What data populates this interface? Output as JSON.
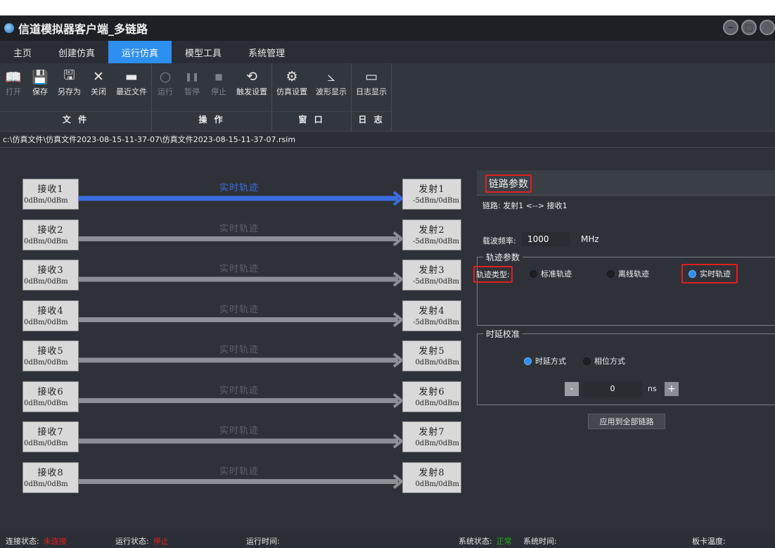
{
  "window": {
    "title": "信道模拟器客户端_多链路"
  },
  "menu": {
    "items": [
      "主页",
      "创建仿真",
      "运行仿真",
      "模型工具",
      "系统管理"
    ],
    "active_index": 2
  },
  "ribbon": {
    "groups": [
      {
        "label": "文 件",
        "buttons": [
          {
            "label": "打开",
            "icon": "open-book-icon",
            "enabled": false
          },
          {
            "label": "保存",
            "icon": "save-icon",
            "enabled": true
          },
          {
            "label": "另存为",
            "icon": "save-as-icon",
            "enabled": true
          },
          {
            "label": "关闭",
            "icon": "close-icon",
            "enabled": true
          },
          {
            "label": "最近文件",
            "icon": "folder-icon",
            "enabled": true
          }
        ]
      },
      {
        "label": "操 作",
        "buttons": [
          {
            "label": "运行",
            "icon": "run-icon",
            "enabled": false
          },
          {
            "label": "暂停",
            "icon": "pause-icon",
            "enabled": false
          },
          {
            "label": "停止",
            "icon": "stop-icon",
            "enabled": false
          },
          {
            "label": "触发设置",
            "icon": "trigger-icon",
            "enabled": true
          }
        ]
      },
      {
        "label": "窗 口",
        "buttons": [
          {
            "label": "仿真设置",
            "icon": "gear-icon",
            "enabled": true
          },
          {
            "label": "波形显示",
            "icon": "chart-icon",
            "enabled": true
          }
        ]
      },
      {
        "label": "日 志",
        "buttons": [
          {
            "label": "日志显示",
            "icon": "monitor-icon",
            "enabled": true
          }
        ]
      }
    ]
  },
  "path": "c:\\仿真文件\\仿真文件2023-08-15-11-37-07\\仿真文件2023-08-15-11-37-07.rsim",
  "links": [
    {
      "rx": "接收1",
      "rx_power": "0dBm/0dBm",
      "label": "实时轨迹",
      "tx": "发射1",
      "tx_power": "-5dBm/0dBm",
      "active": true
    },
    {
      "rx": "接收2",
      "rx_power": "0dBm/0dBm",
      "label": "实时轨迹",
      "tx": "发射2",
      "tx_power": "-5dBm/0dBm",
      "active": false
    },
    {
      "rx": "接收3",
      "rx_power": "0dBm/0dBm",
      "label": "实时轨迹",
      "tx": "发射3",
      "tx_power": "-5dBm/0dBm",
      "active": false
    },
    {
      "rx": "接收4",
      "rx_power": "0dBm/0dBm",
      "label": "实时轨迹",
      "tx": "发射4",
      "tx_power": "-5dBm/0dBm",
      "active": false
    },
    {
      "rx": "接收5",
      "rx_power": "0dBm/0dBm",
      "label": "实时轨迹",
      "tx": "发射5",
      "tx_power": "0dBm/0dBm",
      "active": false
    },
    {
      "rx": "接收6",
      "rx_power": "0dBm/0dBm",
      "label": "实时轨迹",
      "tx": "发射6",
      "tx_power": "0dBm/0dBm",
      "active": false
    },
    {
      "rx": "接收7",
      "rx_power": "0dBm/0dBm",
      "label": "实时轨迹",
      "tx": "发射7",
      "tx_power": "0dBm/0dBm",
      "active": false
    },
    {
      "rx": "接收8",
      "rx_power": "0dBm/0dBm",
      "label": "实时轨迹",
      "tx": "发射8",
      "tx_power": "0dBm/0dBm",
      "active": false
    }
  ],
  "panel": {
    "title": "链路参数",
    "link_info": "链路: 发射1 <--> 接收1",
    "carrier_label": "载波频率:",
    "carrier_value": "1000",
    "carrier_unit": "MHz",
    "track_group": "轨迹参数",
    "track_type_label": "轨迹类型:",
    "track_options": [
      "标准轨迹",
      "离线轨迹",
      "实时轨迹"
    ],
    "track_selected": 2,
    "delay_group": "时延校准",
    "delay_options": [
      "时延方式",
      "相位方式"
    ],
    "delay_selected": 0,
    "delay_value": "0",
    "delay_unit": "ns",
    "minus": "-",
    "plus": "+",
    "apply": "应用到全部链路"
  },
  "status": {
    "conn_label": "连接状态:",
    "conn_value": "未连接",
    "run_label": "运行状态:",
    "run_value": "停止",
    "time_label": "运行时间:",
    "sys_label": "系统状态:",
    "sys_value": "正常",
    "systime_label": "系统时间:",
    "temp_label": "板卡温度:"
  },
  "colors": {
    "accent": "#2d8ff0",
    "active_link": "#3b6de0",
    "idle_link": "#8c8f94",
    "error": "#e02020",
    "ok": "#20b020",
    "highlight_box": "#e02020"
  }
}
